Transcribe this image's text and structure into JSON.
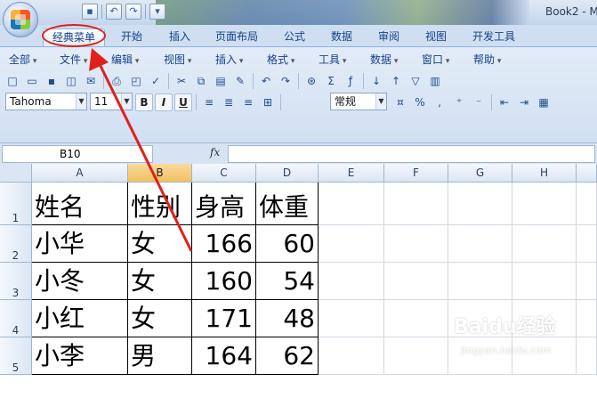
{
  "window": {
    "title": "Book2 - M"
  },
  "tabs": [
    {
      "label": "经典菜单",
      "active": true
    },
    {
      "label": "开始"
    },
    {
      "label": "插入"
    },
    {
      "label": "页面布局"
    },
    {
      "label": "公式"
    },
    {
      "label": "数据"
    },
    {
      "label": "审阅"
    },
    {
      "label": "视图"
    },
    {
      "label": "开发工具"
    }
  ],
  "classic_menu": [
    "全部",
    "文件",
    "编辑",
    "视图",
    "插入",
    "格式",
    "工具",
    "数据",
    "窗口",
    "帮助"
  ],
  "toolbar": {
    "font_name": "Tahoma",
    "font_size": "11",
    "number_format": "常规",
    "bold_label": "B",
    "italic_label": "I",
    "underline_label": "U"
  },
  "formula_bar": {
    "name_box": "B10",
    "fx_label": "fx",
    "value": ""
  },
  "sheet": {
    "columns": [
      "A",
      "B",
      "C",
      "D",
      "E",
      "F",
      "G",
      "H"
    ],
    "selected_column": "B",
    "rows": [
      {
        "num": "1",
        "cells": [
          "姓名",
          "性别",
          "身高",
          "体重"
        ]
      },
      {
        "num": "2",
        "cells": [
          "小华",
          "女",
          "166",
          "60"
        ]
      },
      {
        "num": "3",
        "cells": [
          "小冬",
          "女",
          "160",
          "54"
        ]
      },
      {
        "num": "4",
        "cells": [
          "小红",
          "女",
          "171",
          "48"
        ]
      },
      {
        "num": "5",
        "cells": [
          "小李",
          "男",
          "164",
          "62"
        ]
      }
    ]
  },
  "annotation": {
    "color": "#e0201b"
  },
  "watermark": {
    "text": "Baidu经验",
    "sub": "jingyan.baidu.com"
  }
}
